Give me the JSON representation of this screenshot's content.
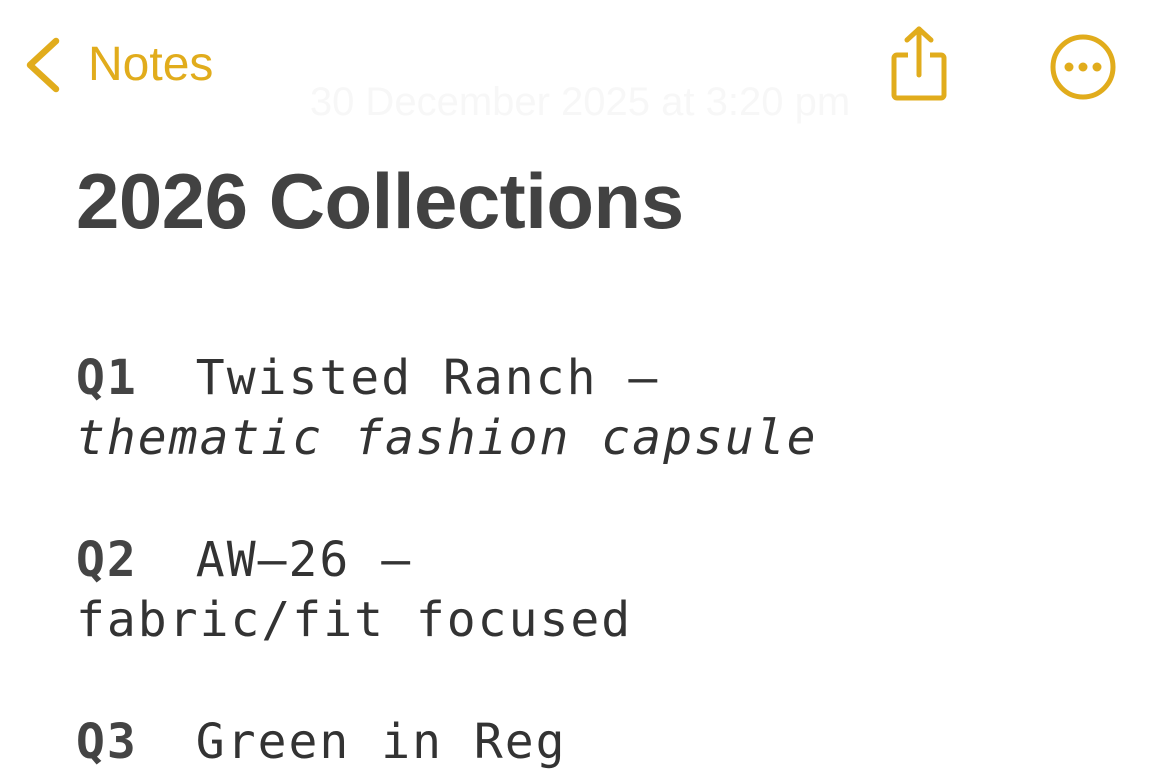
{
  "nav": {
    "back_label": "Notes",
    "accent_color": "#e1ac1c",
    "icons": [
      "chevron-left-icon",
      "share-icon",
      "more-icon"
    ]
  },
  "note": {
    "date": "30 December 2025 at 3:20 pm",
    "title": "2026 Collections",
    "entries": [
      {
        "quarter": "Q1",
        "name": "Twisted Ranch –",
        "description": "thematic fashion capsule"
      },
      {
        "quarter": "Q2",
        "name": "AW–26 –",
        "description": "fabric/fit focused"
      },
      {
        "quarter": "Q3",
        "name": "Green in Reg",
        "description": ""
      }
    ]
  }
}
